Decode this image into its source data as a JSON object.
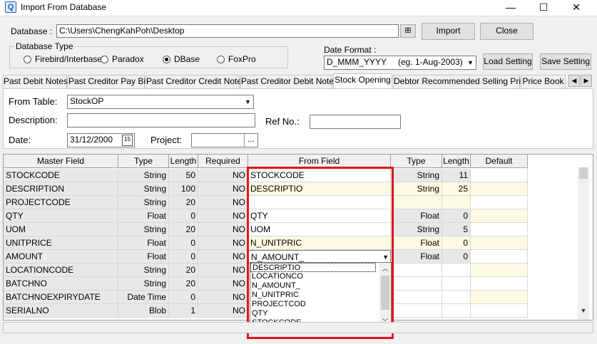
{
  "window": {
    "title": "Import From Database",
    "min": "—",
    "max": "☐",
    "close": "✕"
  },
  "database": {
    "label": "Database :",
    "path": "C:\\Users\\ChengKahPoh\\Desktop",
    "import_btn": "Import",
    "close_btn": "Close",
    "type_label": "Database Type",
    "types": [
      "Firebird/Interbase",
      "Paradox",
      "DBase",
      "FoxPro"
    ],
    "selected_type": "DBase"
  },
  "date_format": {
    "label": "Date Format :",
    "value": "D_MMM_YYYY",
    "example": "(eg. 1-Aug-2003)"
  },
  "buttons": {
    "load_setting": "Load Setting",
    "save_setting": "Save Setting"
  },
  "tabs": [
    "Past Debit Notes",
    "Past Creditor Pay Bill",
    "Past Creditor Credit Notes",
    "Past Creditor Debit Notes",
    "Stock Opening",
    "Debtor Recommended Selling Price",
    "Price Book"
  ],
  "active_tab": "Stock Opening",
  "form": {
    "from_table_label": "From Table:",
    "from_table_value": "StockOP",
    "description_label": "Description:",
    "description_value": "",
    "ref_no_label": "Ref No.:",
    "ref_no_value": "",
    "date_label": "Date:",
    "date_value": "31/12/2000",
    "project_label": "Project:",
    "project_value": "",
    "ellipsis": "..."
  },
  "grid": {
    "headers": [
      "Master Field",
      "Type",
      "Length",
      "Required",
      "From Field",
      "Type",
      "Length",
      "Default"
    ],
    "rows": [
      {
        "master": "STOCKCODE",
        "type": "String",
        "length": "50",
        "required": "NO",
        "from": "STOCKCODE",
        "ftype": "String",
        "flength": "11",
        "default": ""
      },
      {
        "master": "DESCRIPTION",
        "type": "String",
        "length": "100",
        "required": "NO",
        "from": "DESCRIPTIO",
        "ftype": "String",
        "flength": "25",
        "default": ""
      },
      {
        "master": "PROJECTCODE",
        "type": "String",
        "length": "20",
        "required": "NO",
        "from": "",
        "ftype": "",
        "flength": "",
        "default": ""
      },
      {
        "master": "QTY",
        "type": "Float",
        "length": "0",
        "required": "NO",
        "from": "QTY",
        "ftype": "Float",
        "flength": "0",
        "default": ""
      },
      {
        "master": "UOM",
        "type": "String",
        "length": "20",
        "required": "NO",
        "from": "UOM",
        "ftype": "String",
        "flength": "5",
        "default": ""
      },
      {
        "master": "UNITPRICE",
        "type": "Float",
        "length": "0",
        "required": "NO",
        "from": "N_UNITPRIC",
        "ftype": "Float",
        "flength": "0",
        "default": ""
      },
      {
        "master": "AMOUNT",
        "type": "Float",
        "length": "0",
        "required": "NO",
        "from": "N_AMOUNT_",
        "ftype": "Float",
        "flength": "0",
        "default": ""
      },
      {
        "master": "LOCATIONCODE",
        "type": "String",
        "length": "20",
        "required": "NO",
        "from": "",
        "ftype": "",
        "flength": "",
        "default": ""
      },
      {
        "master": "BATCHNO",
        "type": "String",
        "length": "20",
        "required": "NO",
        "from": "",
        "ftype": "",
        "flength": "",
        "default": ""
      },
      {
        "master": "BATCHNOEXPIRYDATE",
        "type": "Date Time",
        "length": "0",
        "required": "NO",
        "from": "",
        "ftype": "",
        "flength": "",
        "default": ""
      },
      {
        "master": "SERIALNO",
        "type": "Blob",
        "length": "1",
        "required": "NO",
        "from": "",
        "ftype": "",
        "flength": "",
        "default": ""
      }
    ],
    "dropdown_options": [
      "DESCRIPTIO",
      "LOCATIONCO",
      "N_AMOUNT_",
      "N_UNITPRIC",
      "PROJECTCOD",
      "QTY",
      "STOCKCODE"
    ]
  },
  "colors": {
    "highlight_box": "#e0161b",
    "row_yellow": "#fbfbe3",
    "row_gray": "#e8e8e8"
  }
}
